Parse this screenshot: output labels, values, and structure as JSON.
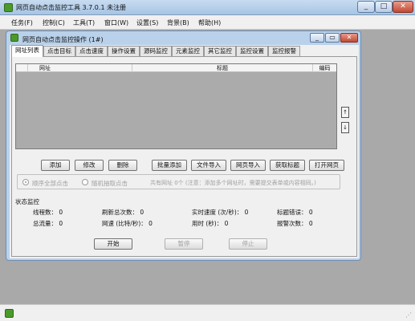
{
  "window": {
    "title": "网页自动点击监控工具 3.7.0.1  未注册"
  },
  "menu": [
    "任务(F)",
    "控制(C)",
    "工具(T)",
    "窗口(W)",
    "设置(S)",
    "背景(B)",
    "帮助(H)"
  ],
  "inner": {
    "title": "网页自动点击监控操作  (1#)",
    "tabs": [
      "网址列表",
      "点击目标",
      "点击速度",
      "操作设置",
      "源码监控",
      "元素监控",
      "其它监控",
      "监控设置",
      "监控报警"
    ],
    "columns": [
      "网址",
      "标题",
      "编码"
    ],
    "spin_up": "↑",
    "spin_down": "↓",
    "buttons": [
      "添加",
      "修改",
      "删除",
      "批量添加",
      "文件导入",
      "网页导入",
      "获取标题",
      "打开网页"
    ],
    "options": {
      "order": "顺序全部点击",
      "random": "随机抽取点击",
      "count": "共有网址  0个  (注意：添加多个网址时，需要提交表单或内容相同。)"
    },
    "status": {
      "heading": "状态监控",
      "row1": [
        "线程数：  0",
        "刷新总次数：  0",
        "实时速度 (次/秒)：  0",
        "标题错误：  0"
      ],
      "row2": [
        "总流量：  0",
        "网速 (比特/秒)：  0",
        "用时 (秒)：  0",
        "报警次数：  0"
      ]
    },
    "controls": {
      "start": "开始",
      "pause": "暂停",
      "stop": "停止"
    }
  }
}
